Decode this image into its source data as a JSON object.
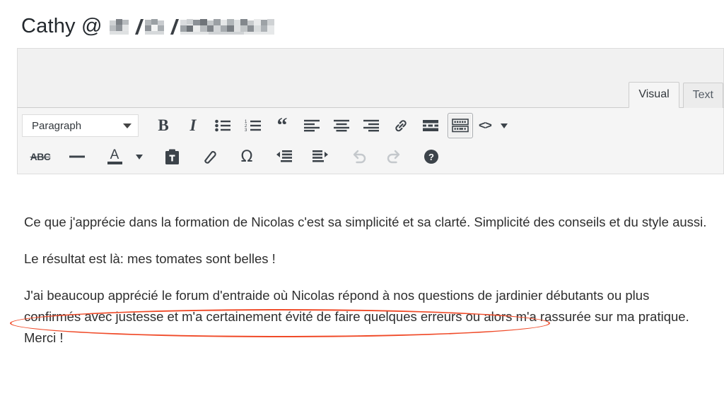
{
  "header": {
    "title_prefix": "Cathy @ ",
    "redacted_date": "▇▇/▇▇/▇ ▇▇▇▇▇▇▇",
    "redaction_note": "pixelated date"
  },
  "editor": {
    "tabs": [
      {
        "id": "visual",
        "label": "Visual",
        "active": true
      },
      {
        "id": "text",
        "label": "Text",
        "active": false
      }
    ],
    "format_select": {
      "value": "Paragraph"
    },
    "toolbar_row1": [
      {
        "name": "bold",
        "label": "B"
      },
      {
        "name": "italic",
        "label": "I"
      },
      {
        "name": "bulleted-list",
        "label": ""
      },
      {
        "name": "numbered-list",
        "label": ""
      },
      {
        "name": "blockquote",
        "label": "“"
      },
      {
        "name": "align-left",
        "label": ""
      },
      {
        "name": "align-center",
        "label": ""
      },
      {
        "name": "align-right",
        "label": ""
      },
      {
        "name": "insert-link",
        "label": ""
      },
      {
        "name": "read-more",
        "label": ""
      },
      {
        "name": "toolbar-toggle",
        "label": "",
        "active": true
      },
      {
        "name": "code",
        "label": "<>"
      }
    ],
    "toolbar_row2": [
      {
        "name": "strikethrough",
        "label": "ABC"
      },
      {
        "name": "horizontal-rule",
        "label": ""
      },
      {
        "name": "text-color",
        "label": "A"
      },
      {
        "name": "paste-as-text",
        "label": ""
      },
      {
        "name": "clear-formatting",
        "label": ""
      },
      {
        "name": "special-character",
        "label": "Ω"
      },
      {
        "name": "outdent",
        "label": ""
      },
      {
        "name": "indent",
        "label": ""
      },
      {
        "name": "undo",
        "label": "",
        "disabled": true
      },
      {
        "name": "redo",
        "label": "",
        "disabled": true
      },
      {
        "name": "keyboard-shortcuts-help",
        "label": "?"
      }
    ],
    "content": {
      "paragraph1": "Ce que j'apprécie dans la formation de Nicolas c'est sa simplicité et sa clarté. Simplicité des conseils et du style aussi.",
      "paragraph2": "Le résultat est là: mes tomates sont belles !",
      "paragraph3": "J'ai beaucoup apprécié le forum d'entraide où Nicolas répond à nos questions de jardinier débutants ou plus confirmés avec justesse et m'a certainement évité de faire quelques erreurs ou alors m'a rassurée sur ma pratique. Merci !"
    }
  },
  "annotation": {
    "type": "ellipse",
    "color": "#f04a28",
    "encircled_text": "J'ai beaucoup apprécié le forum d'entraide où Nicolas répond à nos questions"
  },
  "colors": {
    "accent": "#f04a28",
    "toolbar_bg": "#f5f5f5",
    "media_bg": "#f1f1f1",
    "border": "#dddddd",
    "icon": "#3c434a",
    "text": "#2e2e2e",
    "title": "#23282d"
  }
}
